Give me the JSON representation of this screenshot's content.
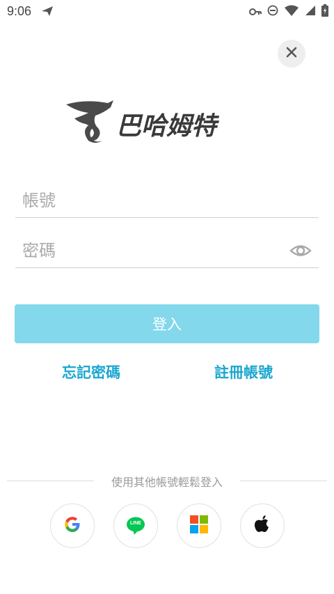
{
  "status_bar": {
    "time": "9:06",
    "icons": [
      "send-icon",
      "vpn-key-icon",
      "do-not-disturb-icon",
      "wifi-icon",
      "signal-icon",
      "battery-charging-icon"
    ]
  },
  "header": {
    "close_icon": "close-icon"
  },
  "logo": {
    "text": "巴哈姆特",
    "icon": "dragon-icon"
  },
  "form": {
    "account_placeholder": "帳號",
    "account_value": "",
    "password_placeholder": "密碼",
    "password_value": "",
    "login_label": "登入",
    "forgot_label": "忘記密碼",
    "register_label": "註冊帳號"
  },
  "social": {
    "divider_text": "使用其他帳號輕鬆登入",
    "providers": [
      "google-icon",
      "line-icon",
      "microsoft-icon",
      "apple-icon"
    ],
    "line_badge_text": "LINE"
  },
  "colors": {
    "accent": "#1aa6cf",
    "login_button": "#83d8ec",
    "line_green": "#06c755"
  }
}
